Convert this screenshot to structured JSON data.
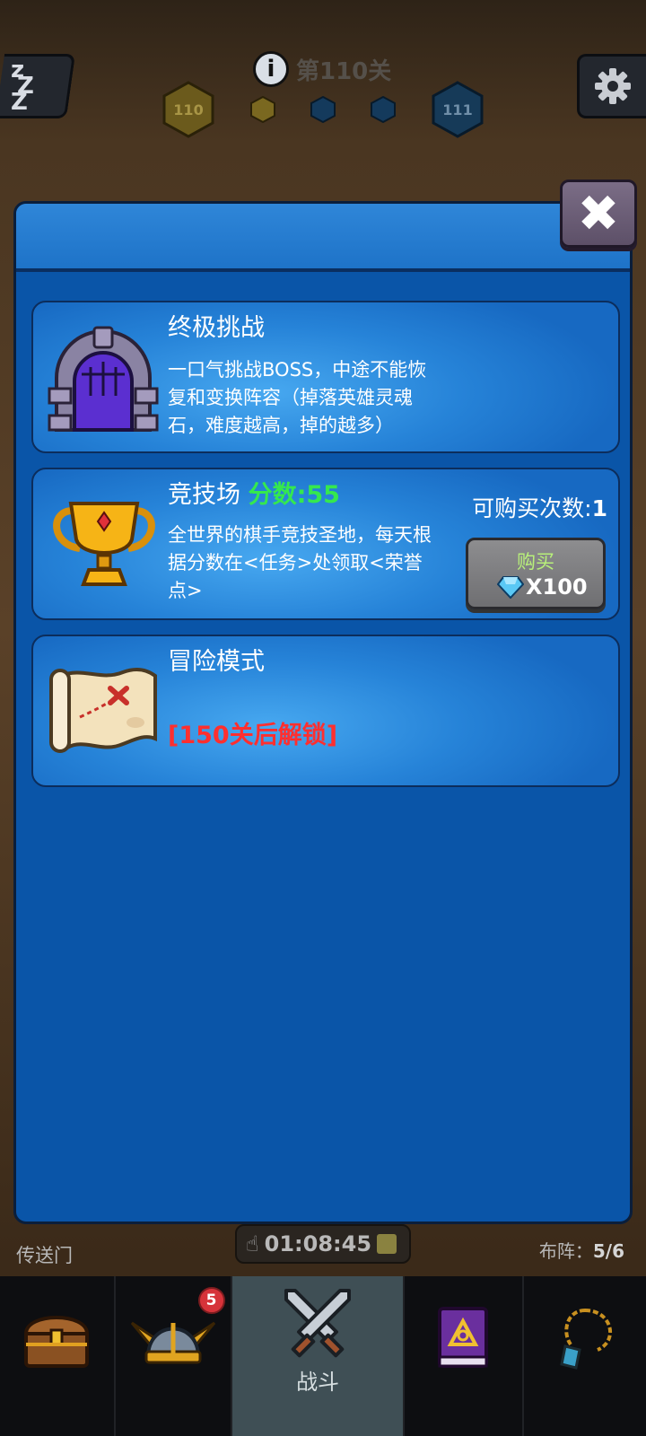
{
  "hud": {
    "stage_title": "第110关",
    "current_level": "110",
    "next_level": "111",
    "sleep_icon_text": "zZZ"
  },
  "modes": [
    {
      "title": "终极挑战",
      "description": "一口气挑战BOSS，中途不能恢复和变换阵容（掉落英雄灵魂石，难度越高，掉的越多）",
      "icon": "castle-gate-icon"
    },
    {
      "title": "竞技场",
      "score_label": "分数:55",
      "description": "全世界的棋手竞技圣地，每天根据分数在<任务>处领取<荣誉点>",
      "buy_count_label": "可购买次数:",
      "buy_count_value": "1",
      "buy_button_label": "购买",
      "buy_price": "X100",
      "icon": "trophy-icon"
    },
    {
      "title": "冒险模式",
      "lock_text": "[150关后解锁]",
      "icon": "treasure-map-icon"
    }
  ],
  "bottom_strip": {
    "portal_label": "传送门",
    "timer": "01:08:45",
    "formation_label": "布阵：",
    "formation_value": "5/6"
  },
  "nav": {
    "items": [
      {
        "id": "shop",
        "icon": "treasure-chest-icon",
        "label": ""
      },
      {
        "id": "heroes",
        "icon": "viking-helmet-icon",
        "label": "",
        "badge": "5"
      },
      {
        "id": "battle",
        "icon": "crossed-swords-icon",
        "label": "战斗"
      },
      {
        "id": "book",
        "icon": "spell-book-icon",
        "label": ""
      },
      {
        "id": "necklace",
        "icon": "amulet-icon",
        "label": ""
      }
    ]
  },
  "colors": {
    "modal_blue": "#0a55a8",
    "card_blue": "#2683d8",
    "score_green": "#35e84e",
    "lock_red": "#ff2f2f"
  }
}
